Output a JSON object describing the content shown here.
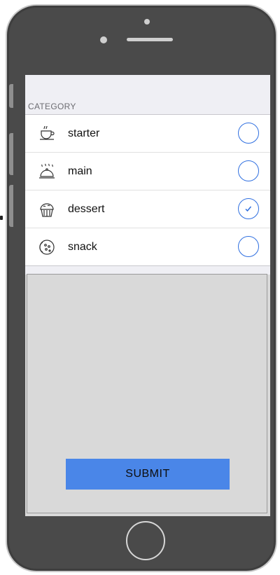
{
  "section": {
    "title": "CATEGORY"
  },
  "categories": [
    {
      "label": "starter",
      "icon": "teacup-icon",
      "selected": false
    },
    {
      "label": "main",
      "icon": "cloche-icon",
      "selected": false
    },
    {
      "label": "dessert",
      "icon": "cupcake-icon",
      "selected": true
    },
    {
      "label": "snack",
      "icon": "cookie-icon",
      "selected": false
    }
  ],
  "submit": {
    "label": "SUBMIT"
  },
  "colors": {
    "accent": "#2f6fe0",
    "button": "#4a86e8",
    "frame": "#4a4a4a",
    "screen_bg": "#d9d9d9"
  }
}
